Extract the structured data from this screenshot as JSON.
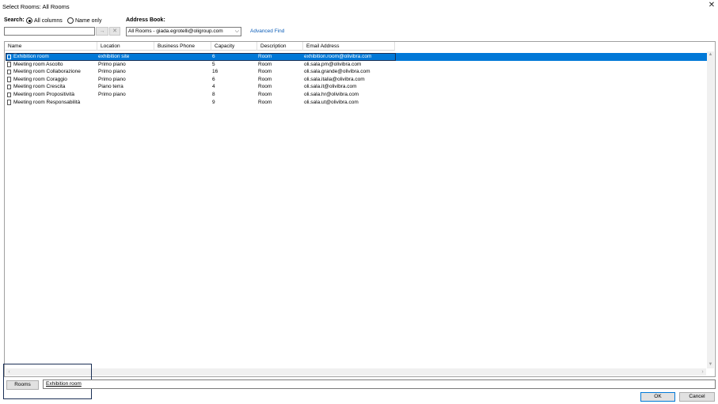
{
  "window": {
    "title": "Select Rooms: All Rooms"
  },
  "search": {
    "label": "Search:",
    "option_all": "All columns",
    "option_name": "Name only",
    "value": "",
    "go_glyph": "→",
    "clear_glyph": "✕"
  },
  "address_book": {
    "label": "Address Book:",
    "selected": "All Rooms - giada.egrotelli@oligroup.com",
    "advanced_find": "Advanced Find"
  },
  "columns": [
    "Name",
    "Location",
    "Business Phone",
    "Capacity",
    "Description",
    "Email Address"
  ],
  "rows": [
    {
      "name": "Exhibition room",
      "location": "exhibition site",
      "phone": "",
      "capacity": "6",
      "description": "Room",
      "email": "exhibition.room@olivibra.com"
    },
    {
      "name": "Meeting room Ascolto",
      "location": "Primo piano",
      "phone": "",
      "capacity": "5",
      "description": "Room",
      "email": "oli.sala.pm@olivibra.com"
    },
    {
      "name": "Meeting room Collaborazione",
      "location": "Primo piano",
      "phone": "",
      "capacity": "16",
      "description": "Room",
      "email": "oli.sala.grande@olivibra.com"
    },
    {
      "name": "Meeting room Coraggio",
      "location": "Primo piano",
      "phone": "",
      "capacity": "6",
      "description": "Room",
      "email": "oli.sala.italia@olivibra.com"
    },
    {
      "name": "Meeting room Crescita",
      "location": "Piano terra",
      "phone": "",
      "capacity": "4",
      "description": "Room",
      "email": "oli.sala.it@olivibra.com"
    },
    {
      "name": "Meeting room Propositività",
      "location": "Primo piano",
      "phone": "",
      "capacity": "8",
      "description": "Room",
      "email": "oli.sala.hr@olivibra.com"
    },
    {
      "name": "Meeting room Responsabilità",
      "location": "",
      "phone": "",
      "capacity": "9",
      "description": "Room",
      "email": "oli.sala.ut@olivibra.com"
    }
  ],
  "selected_row": 0,
  "rooms": {
    "button_label": "Rooms",
    "value": "Exhibition room"
  },
  "buttons": {
    "ok": "OK",
    "cancel": "Cancel"
  },
  "colors": {
    "selection": "#0078d7",
    "link": "#0b5db8",
    "outline": "#1a2f55"
  }
}
